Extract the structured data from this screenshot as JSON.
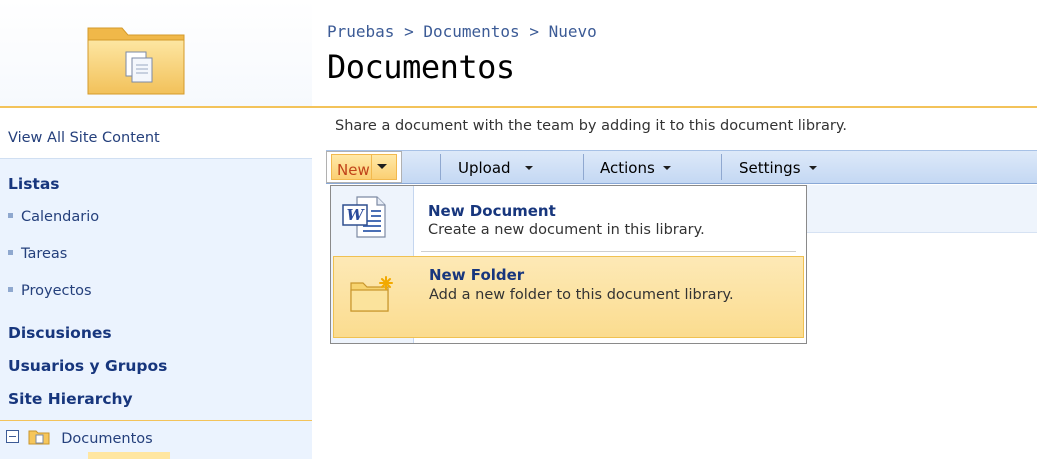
{
  "header": {
    "breadcrumb": [
      "Pruebas",
      "Documentos",
      "Nuevo"
    ],
    "breadcrumb_separator": ">",
    "title": "Documentos",
    "site_icon": "folder-documents-icon"
  },
  "leftnav": {
    "view_all": "View All Site Content",
    "lists_heading": "Listas",
    "lists": [
      "Calendario",
      "Tareas",
      "Proyectos"
    ],
    "discussions_heading": "Discusiones",
    "users_heading": "Usuarios y Grupos",
    "hierarchy_heading": "Site Hierarchy",
    "tree_item": "Documentos"
  },
  "main": {
    "description": "Share a document with the team by adding it to this document library."
  },
  "toolbar": {
    "new_label": "New",
    "upload_label": "Upload",
    "actions_label": "Actions",
    "settings_label": "Settings"
  },
  "new_menu": {
    "items": [
      {
        "title": "New Document",
        "description": "Create a new document in this library.",
        "icon": "word-document-icon"
      },
      {
        "title": "New Folder",
        "description": "Add a new folder to this document library.",
        "icon": "new-folder-icon"
      }
    ]
  },
  "colors": {
    "accent_gold": "#f3c35a",
    "link_blue": "#17367d",
    "toolbar_blue": "#c4d8f3",
    "new_button_text": "#c0431a"
  }
}
